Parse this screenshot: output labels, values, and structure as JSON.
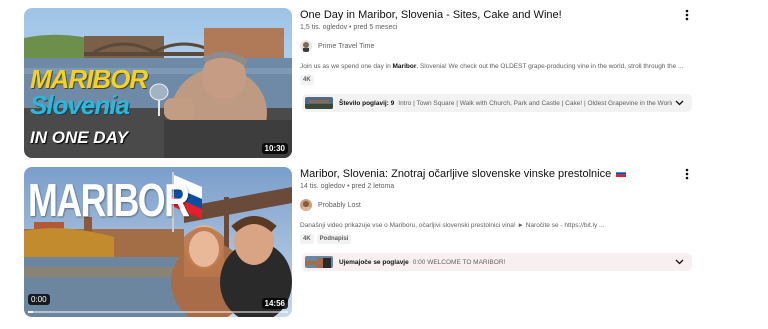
{
  "results": [
    {
      "title": "One Day in Maribor, Slovenia - Sites, Cake and Wine!",
      "meta": "1,5 tis. ogledov • pred 5 meseci",
      "channel": "Prime Travel Time",
      "description_before": "Join us as we spend one day in ",
      "description_bold": "Maribor",
      "description_after": ", Slovenia! We check out the OLDEST grape-producing vine in the world, stroll through the ...",
      "badges": [
        "4K"
      ],
      "duration": "10:30",
      "thumb_text": {
        "line1": "MARIBOR",
        "line2": "Slovenia",
        "line3": "IN ONE DAY"
      },
      "chapters_label": "Število poglavij: 9",
      "chapters_text": "Intro | Town Square | Walk with Church, Park and Castle | Cake! | Oldest Grapevine in the World | ..."
    },
    {
      "title": "Maribor, Slovenia: Znotraj očarljive slovenske vinske prestolnice",
      "title_flag": "si-flag-icon",
      "meta": "14 tis. ogledov • pred 2 letoma",
      "channel": "Probably Lost",
      "description": "Današnji video prikazuje vse o Mariboru, očarljivi slovenski prestolnici vina! ► Naročite se - https://bit.ly ...",
      "badges": [
        "4K",
        "Podnapisi"
      ],
      "duration": "14:56",
      "timestamp": "0:00",
      "progress": 0.02,
      "thumb_text": {
        "line1": "MARIBOR"
      },
      "chapters_label": "Ujemajoče se poglavje",
      "chapters_text": "0:00 WELCOME TO MARIBOR!"
    }
  ],
  "colors": {
    "text_primary": "#0f0f0f",
    "text_secondary": "#606060",
    "chip_bg": "#f2f2f2"
  }
}
